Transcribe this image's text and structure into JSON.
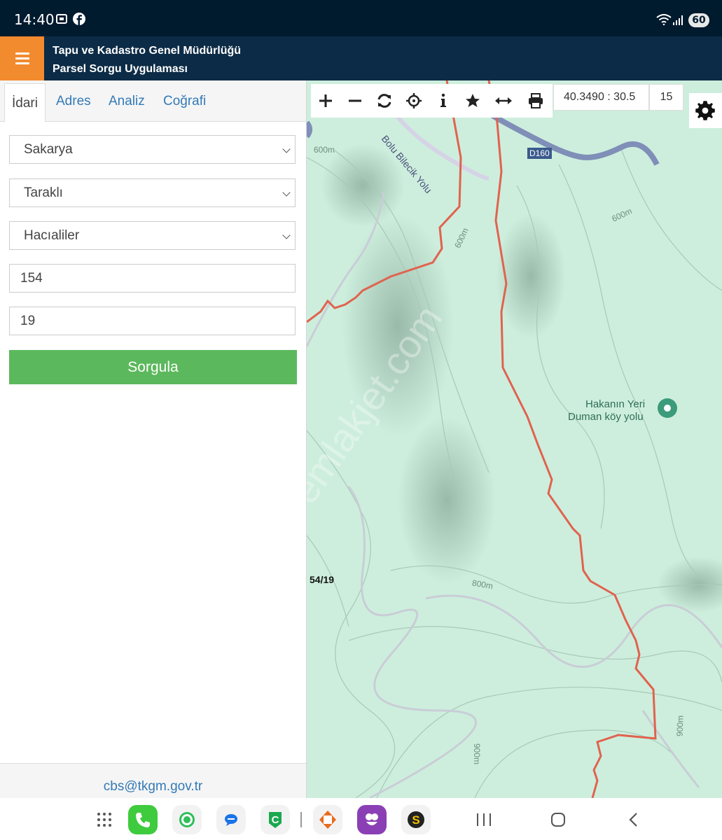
{
  "status_bar": {
    "time": "14:40",
    "battery": "60",
    "icons": [
      "screenshot-icon",
      "facebook-icon",
      "wifi-icon",
      "signal-icon",
      "battery-icon"
    ]
  },
  "app_bar": {
    "title_line1": "Tapu ve Kadastro Genel Müdürlüğü",
    "title_line2": "Parsel Sorgu Uygulaması",
    "menu_color": "#f28a2e",
    "bar_color": "#0c2b46"
  },
  "panel": {
    "tabs": [
      {
        "label": "İdari",
        "active": true
      },
      {
        "label": "Adres",
        "active": false
      },
      {
        "label": "Analiz",
        "active": false
      },
      {
        "label": "Coğrafi",
        "active": false
      }
    ],
    "province_select": "Sakarya",
    "district_select": "Taraklı",
    "neighborhood_select": "Hacıaliler",
    "block_value": "154",
    "parcel_value": "19",
    "query_button": "Sorgula",
    "button_color": "#5cb85c",
    "footer_email": "cbs@tkgm.gov.tr"
  },
  "map": {
    "toolbar": [
      "zoom-in-icon",
      "zoom-out-icon",
      "refresh-icon",
      "locate-icon",
      "info-icon",
      "favorite-star-icon",
      "measure-icon",
      "print-icon"
    ],
    "coordinates": "40.3490 : 30.5",
    "zoom_level": "15",
    "labels": {
      "road_name": "Bolu Bilecik Yolu",
      "road_code": "D160",
      "place_line1": "Hakanın Yeri",
      "place_line2": "Duman köy yolu",
      "contour_600": "600m",
      "contour_800": "800m",
      "contour_900": "900m",
      "parcel_label": "54/19",
      "watermark": "emlakjet.com"
    },
    "terrain_color": "#cdeedd",
    "boundary_color": "#e0634f"
  },
  "nav_bar": {
    "apps": [
      "apps-grid-icon",
      "phone-icon",
      "whatsapp-icon",
      "messages-icon",
      "caller-app-icon",
      "edevlet-app-icon",
      "flower-app-icon",
      "s-app-icon"
    ],
    "buttons": [
      "recent-apps-button",
      "home-button",
      "back-button"
    ]
  }
}
